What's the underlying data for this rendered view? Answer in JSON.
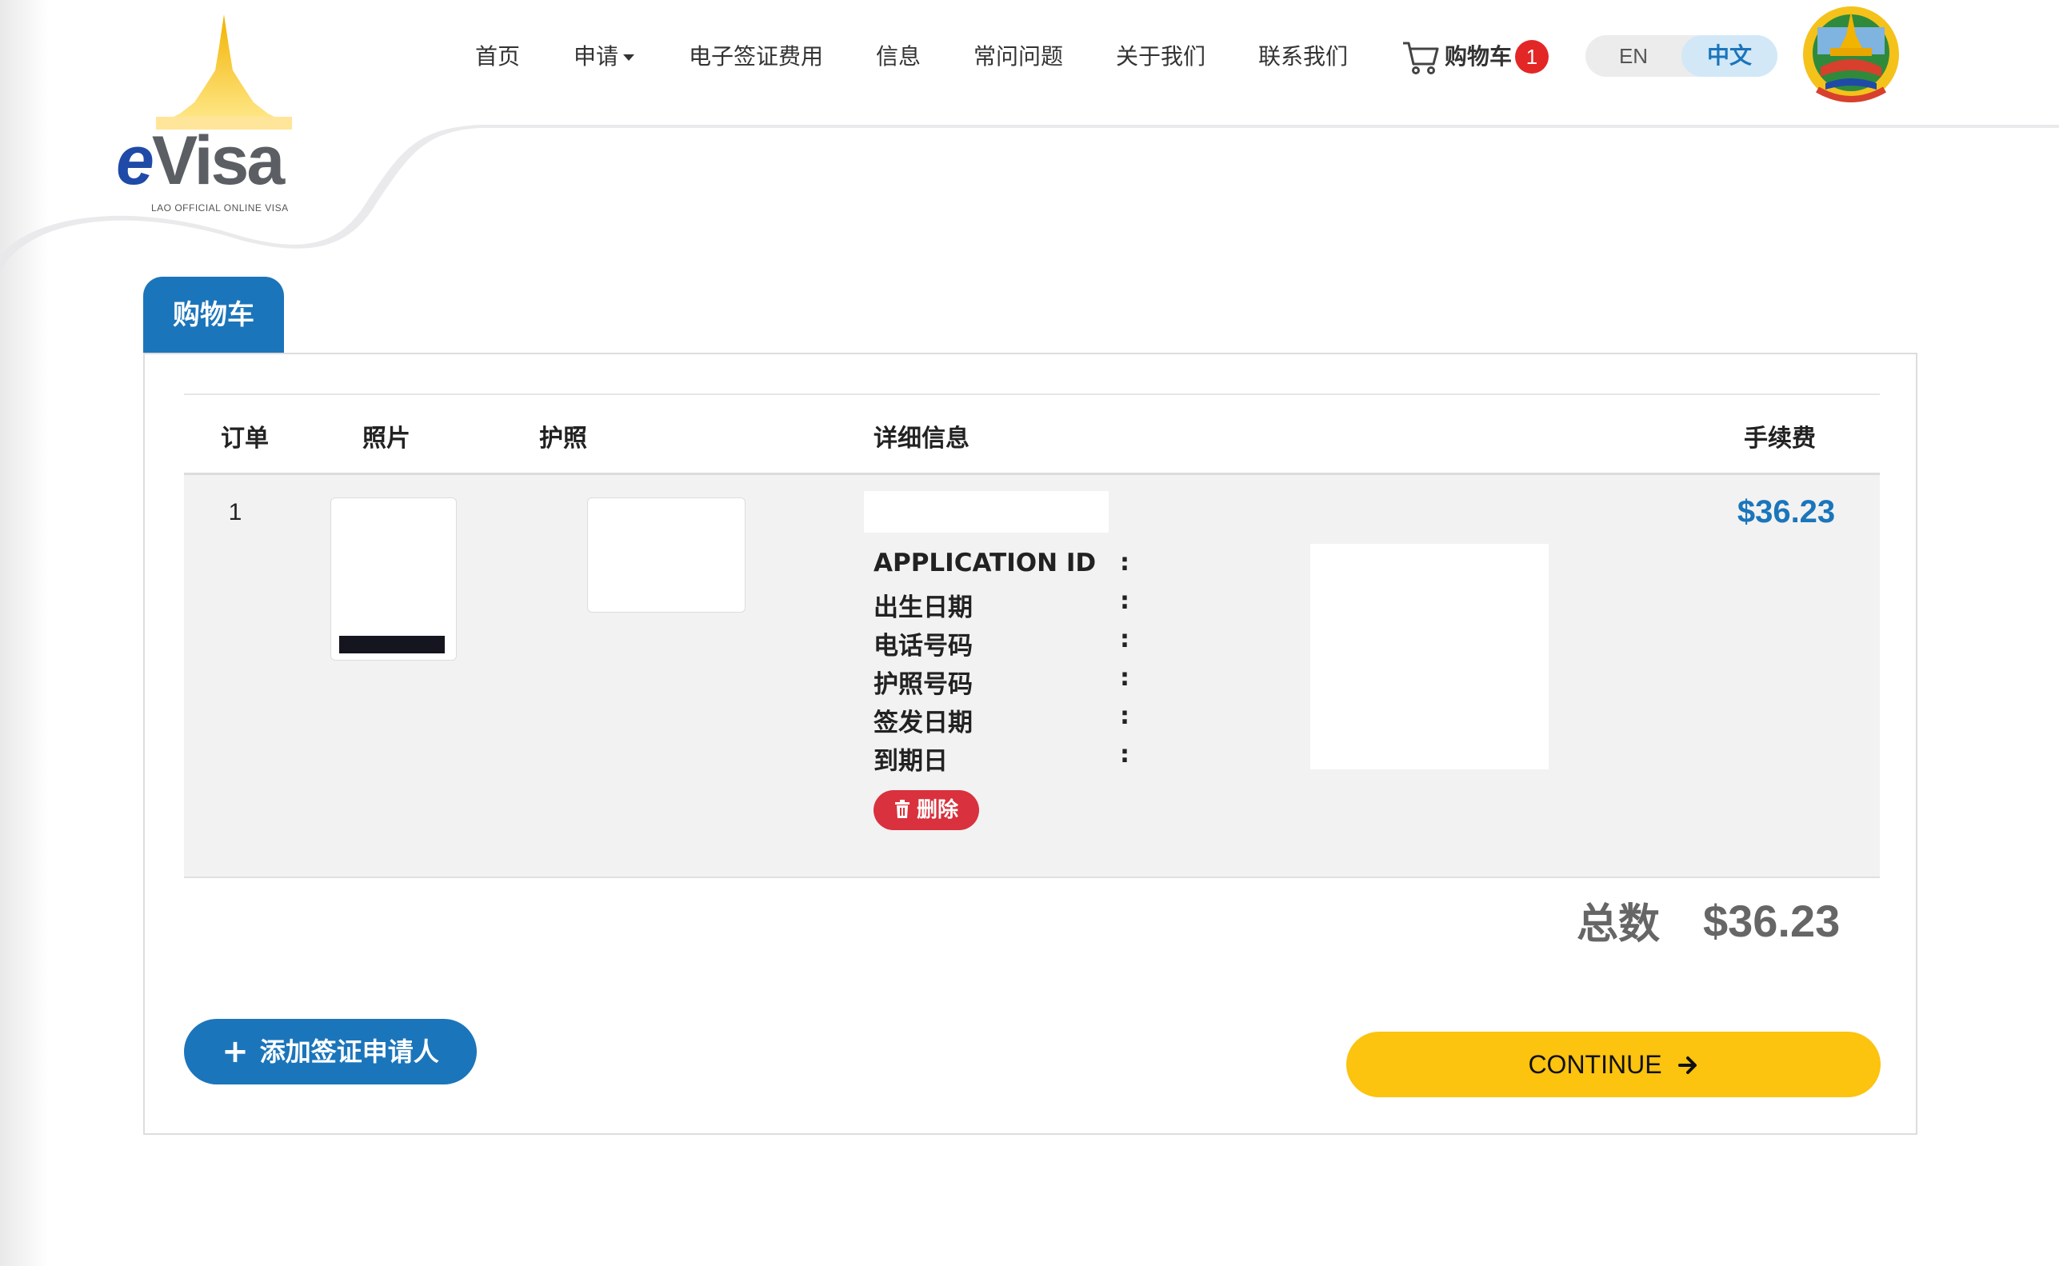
{
  "brand": {
    "logo_main": "Visa",
    "logo_e": "e",
    "logo_subtitle": "LAO OFFICIAL ONLINE VISA"
  },
  "nav": {
    "items": [
      {
        "label": "首页"
      },
      {
        "label": "申请"
      },
      {
        "label": "电子签证费用"
      },
      {
        "label": "信息"
      },
      {
        "label": "常问问题"
      },
      {
        "label": "关于我们"
      },
      {
        "label": "联系我们"
      }
    ],
    "cart_label": "购物车",
    "cart_count": "1",
    "lang_en": "EN",
    "lang_zh": "中文"
  },
  "cart": {
    "tab_title": "购物车",
    "headers": {
      "order": "订单",
      "photo": "照片",
      "passport": "护照",
      "details": "详细信息",
      "fee": "手续费"
    },
    "rows": [
      {
        "order_no": "1",
        "detail_labels": [
          "APPLICATION ID",
          "出生日期",
          "电话号码",
          "护照号码",
          "签发日期",
          "到期日"
        ],
        "colon": ":",
        "delete_label": "删除",
        "fee": "$36.23"
      }
    ],
    "total_label": "总数",
    "total_value": "$36.23",
    "add_applicant_label": "添加签证申请人",
    "continue_label": "CONTINUE"
  },
  "colors": {
    "primary": "#1b75bb",
    "danger": "#d9313d",
    "accent": "#fcc30f",
    "badge": "#e32726"
  }
}
